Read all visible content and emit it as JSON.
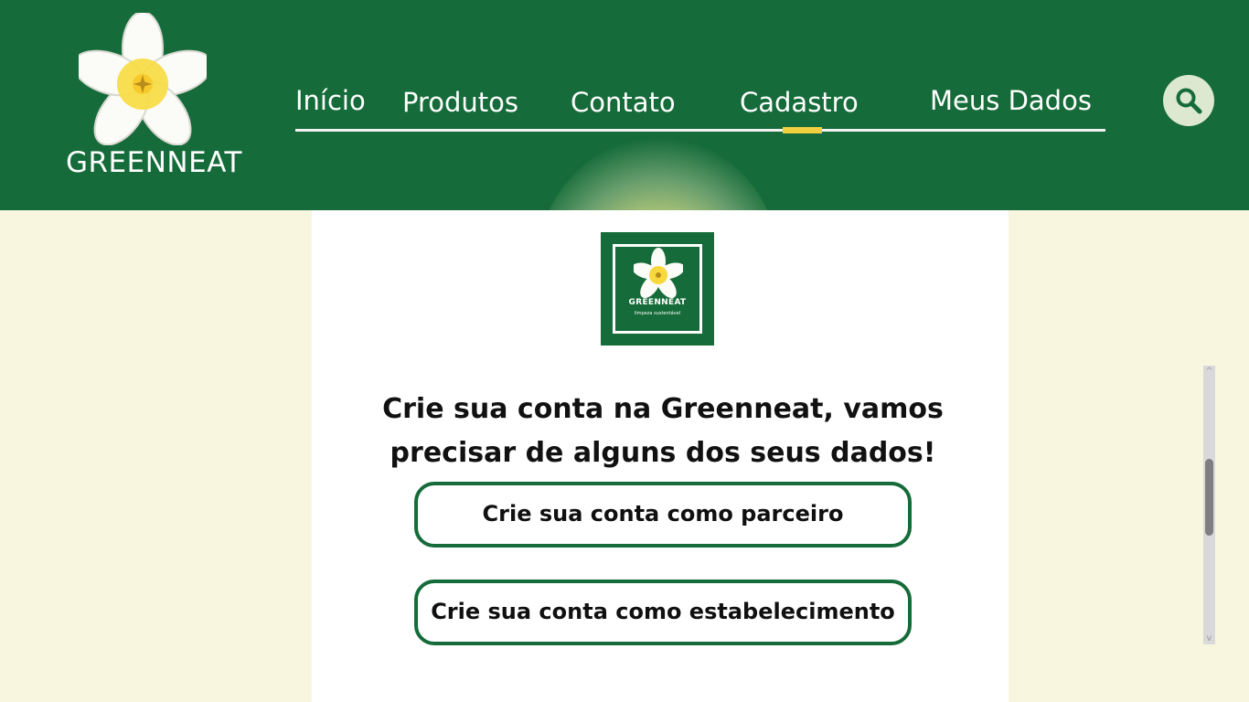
{
  "brand": {
    "name": "GREENNEAT",
    "badge_name": "GREENNEAT",
    "badge_tagline": "limpeza sustentável"
  },
  "navigation": {
    "items": [
      {
        "label": "Início"
      },
      {
        "label": "Produtos"
      },
      {
        "label": "Contato"
      },
      {
        "label": "Cadastro"
      },
      {
        "label": "Meus Dados"
      }
    ],
    "active_item": "Cadastro"
  },
  "search": {
    "icon": "search-icon"
  },
  "main": {
    "headline": "Crie sua conta na Greenneat, vamos precisar de alguns dos seus dados!",
    "buttons": [
      {
        "label": "Crie sua conta como parceiro"
      },
      {
        "label": "Crie sua conta como estabelecimento"
      }
    ]
  },
  "colors": {
    "header_green": "#156b39",
    "page_cream": "#f8f6df",
    "active_yellow": "#f1d03f",
    "search_circle": "#dce8cf"
  }
}
